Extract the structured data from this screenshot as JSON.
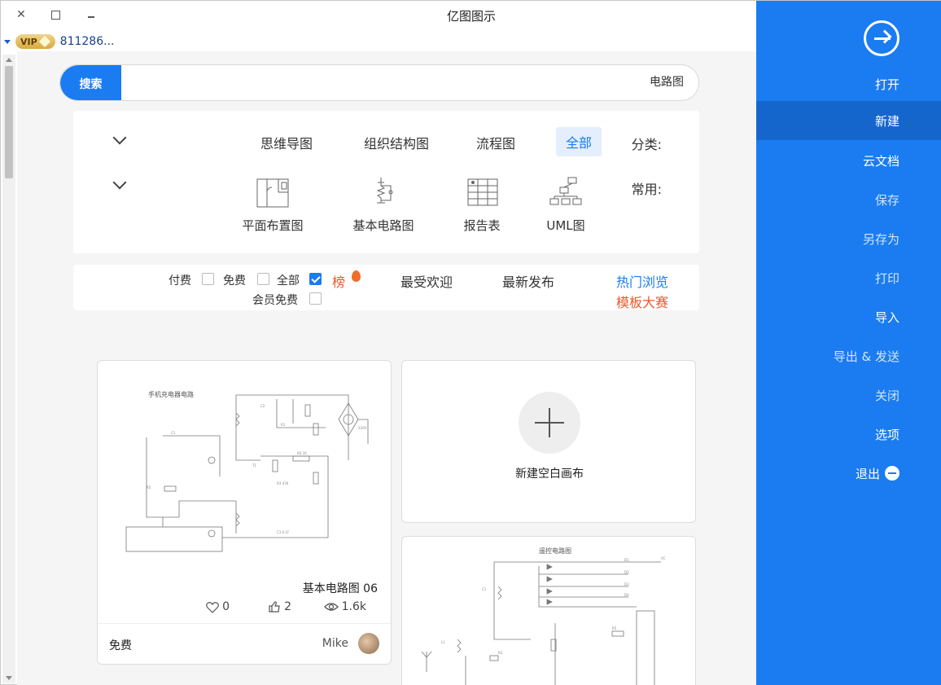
{
  "window": {
    "title": "亿图图示",
    "close_glyph": "✕"
  },
  "user": {
    "vip_label": "VIP",
    "id": "811286..."
  },
  "search": {
    "button_label": "搜索",
    "value": "电路图",
    "placeholder": ""
  },
  "categories": {
    "label": "分类:",
    "items": [
      "全部",
      "流程图",
      "组织结构图",
      "思维导图"
    ],
    "active": "全部"
  },
  "common": {
    "label": "常用:",
    "items": [
      {
        "label": "UML图",
        "icon": "uml-icon"
      },
      {
        "label": "报告表",
        "icon": "report-table-icon"
      },
      {
        "label": "基本电路图",
        "icon": "circuit-icon"
      },
      {
        "label": "平面布置图",
        "icon": "floor-plan-icon"
      }
    ]
  },
  "filters": {
    "sort_hot": "热门浏览",
    "sort_contest": "模板大赛",
    "sort_new": "最新发布",
    "sort_popular": "最受欢迎",
    "rank_label": "榜",
    "all_label": "全部",
    "free_label": "免费",
    "paid_label": "付费",
    "member_free_label": "会员免费"
  },
  "cards": {
    "new_blank": "新建空白画布",
    "template1": {
      "title": "基本电路图 06",
      "views": "1.6k",
      "likes": "2",
      "favorites": "0",
      "author": "Mike",
      "price": "免费",
      "diagram_caption": "手机充电器电路"
    },
    "template2": {
      "diagram_caption": "遥控电路图"
    }
  },
  "sidebar": {
    "items": [
      "打开",
      "新建",
      "云文档",
      "保存",
      "另存为",
      "打印",
      "导入",
      "导出 & 发送",
      "关闭",
      "选项",
      "退出"
    ],
    "active": "新建"
  },
  "colors": {
    "accent": "#1a7cf0",
    "sidebar_active": "#1466cc",
    "hot": "#e95a2a"
  }
}
